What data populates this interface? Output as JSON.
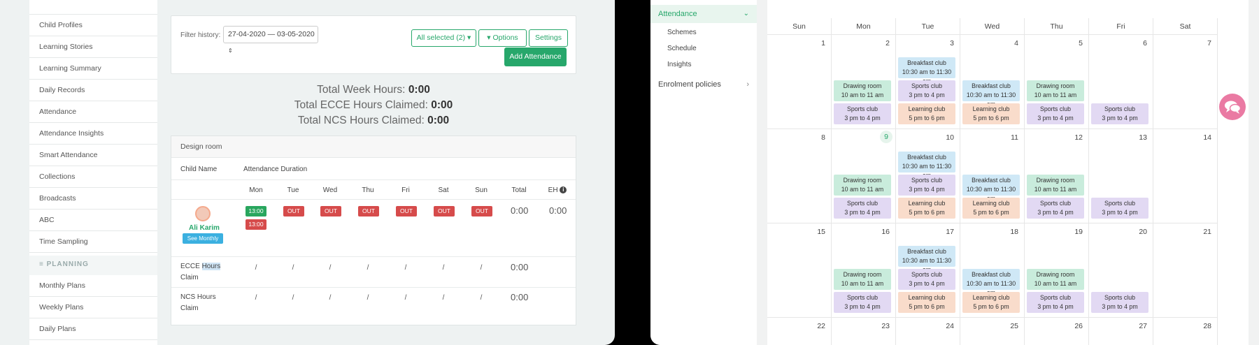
{
  "left_sidebar": {
    "items": [
      "Child Profiles",
      "Learning Stories",
      "Learning Summary",
      "Daily Records",
      "Attendance",
      "Attendance Insights",
      "Smart Attendance",
      "Collections",
      "Broadcasts",
      "ABC",
      "Time Sampling"
    ],
    "planning_label": "PLANNING",
    "planning_items": [
      "Monthly Plans",
      "Weekly Plans",
      "Daily Plans"
    ]
  },
  "filter": {
    "label": "Filter history:",
    "date_range": "27-04-2020 — 03-05-2020",
    "all_selected": "All selected (2)",
    "options": "Options",
    "settings": "Settings",
    "add_attendance": "Add Attendance"
  },
  "totals": {
    "week_label": "Total Week Hours:",
    "week_value": "0:00",
    "ecce_label": "Total ECCE Hours Claimed:",
    "ecce_value": "0:00",
    "ncs_label": "Total NCS Hours Claimed:",
    "ncs_value": "0:00"
  },
  "attendance_table": {
    "room": "Design room",
    "col_child": "Child Name",
    "col_duration": "Attendance Duration",
    "days": [
      "Mon",
      "Tue",
      "Wed",
      "Thu",
      "Fri",
      "Sat",
      "Sun"
    ],
    "col_total": "Total",
    "col_eh": "EH",
    "child": {
      "name": "Ali Karim",
      "see_monthly": "See Monthly",
      "mon_in": "13:00",
      "mon_out": "13:00",
      "out_label": "OUT",
      "total": "0:00",
      "eh": "0:00"
    },
    "ecce_label_1": "ECCE",
    "ecce_label_highlight": "Hours",
    "ecce_label_2": "Claim",
    "ncs_label": "NCS Hours Claim",
    "slash": "/",
    "ecce_total": "0:00",
    "ncs_total": "0:00"
  },
  "right_sidebar": {
    "attendance": "Attendance",
    "subitems": [
      "Schemes",
      "Schedule",
      "Insights"
    ],
    "enrolment": "Enrolment policies"
  },
  "calendar": {
    "weekdays": [
      "Sun",
      "Mon",
      "Tue",
      "Wed",
      "Thu",
      "Fri",
      "Sat"
    ],
    "weeks": [
      [
        "1",
        "2",
        "3",
        "4",
        "5",
        "6",
        "7"
      ],
      [
        "8",
        "9",
        "10",
        "11",
        "12",
        "13",
        "14"
      ],
      [
        "15",
        "16",
        "17",
        "18",
        "19",
        "20",
        "21"
      ],
      [
        "22",
        "23",
        "24",
        "25",
        "26",
        "27",
        "28"
      ]
    ],
    "today": "9",
    "events": {
      "breakfast": {
        "title": "Breakfast club",
        "time": "10:30 am to 11:30 am"
      },
      "drawing": {
        "title": "Drawing room",
        "time": "10 am to 11 am"
      },
      "sports": {
        "title": "Sports club",
        "time": "3 pm to 4 pm"
      },
      "learning": {
        "title": "Learning club",
        "time": "5 pm to 6 pm"
      }
    },
    "colors": {
      "breakfast": "#cfe8f6",
      "drawing": "#c9ecdc",
      "sports": "#e2d9f3",
      "learning": "#f9dccb"
    }
  }
}
